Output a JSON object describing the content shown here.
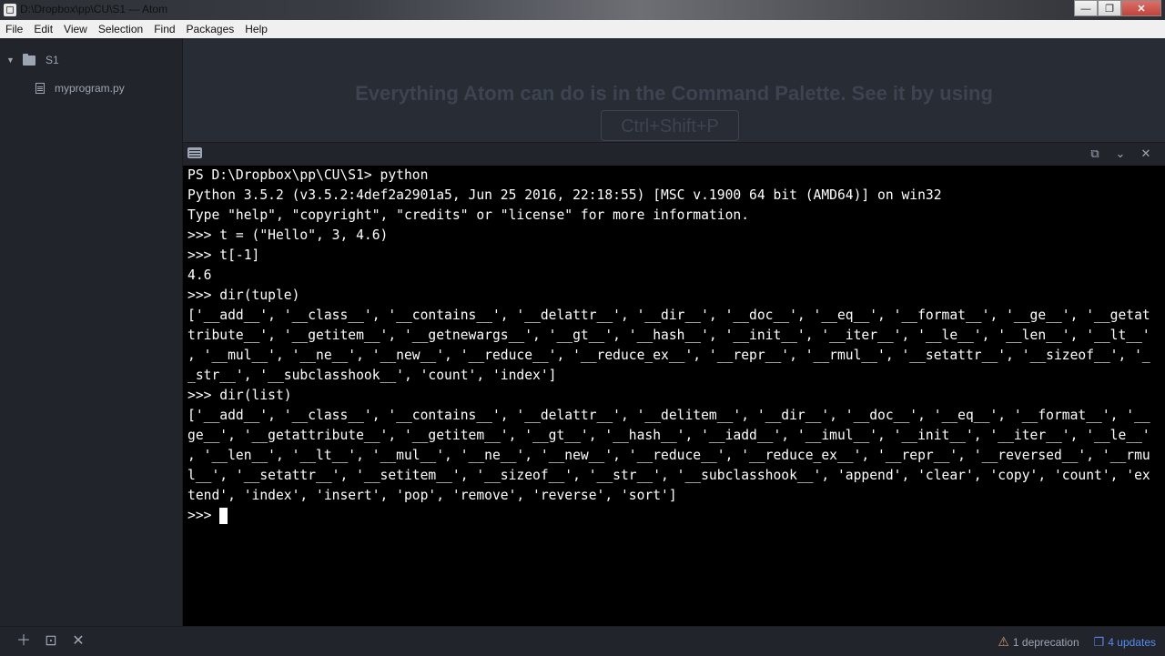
{
  "window": {
    "title": "D:\\Dropbox\\pp\\CU\\S1 — Atom",
    "min_glyph": "—",
    "max_glyph": "❐",
    "close_glyph": "✕"
  },
  "menu": [
    "File",
    "Edit",
    "View",
    "Selection",
    "Find",
    "Packages",
    "Help"
  ],
  "tree": {
    "folder": "S1",
    "file": "myprogram.py"
  },
  "workspace": {
    "hint": "Everything Atom can do is in the Command Palette. See it by using",
    "shortcut": "Ctrl+Shift+P"
  },
  "terminal": {
    "lines": [
      "PS D:\\Dropbox\\pp\\CU\\S1> python",
      "Python 3.5.2 (v3.5.2:4def2a2901a5, Jun 25 2016, 22:18:55) [MSC v.1900 64 bit (AMD64)] on win32",
      "Type \"help\", \"copyright\", \"credits\" or \"license\" for more information.",
      ">>> t = (\"Hello\", 3, 4.6)",
      ">>> t[-1]",
      "4.6",
      ">>> dir(tuple)",
      "['__add__', '__class__', '__contains__', '__delattr__', '__dir__', '__doc__', '__eq__', '__format__', '__ge__', '__getat",
      "tribute__', '__getitem__', '__getnewargs__', '__gt__', '__hash__', '__init__', '__iter__', '__le__', '__len__', '__lt__'",
      ", '__mul__', '__ne__', '__new__', '__reduce__', '__reduce_ex__', '__repr__', '__rmul__', '__setattr__', '__sizeof__', '_",
      "_str__', '__subclasshook__', 'count', 'index']",
      ">>> dir(list)",
      "['__add__', '__class__', '__contains__', '__delattr__', '__delitem__', '__dir__', '__doc__', '__eq__', '__format__', '__",
      "ge__', '__getattribute__', '__getitem__', '__gt__', '__hash__', '__iadd__', '__imul__', '__init__', '__iter__', '__le__'",
      ", '__len__', '__lt__', '__mul__', '__ne__', '__new__', '__reduce__', '__reduce_ex__', '__repr__', '__reversed__', '__rmu",
      "l__', '__setattr__', '__setitem__', '__sizeof__', '__str__', '__subclasshook__', 'append', 'clear', 'copy', 'count', 'ex",
      "tend', 'index', 'insert', 'pop', 'remove', 'reverse', 'sort']"
    ],
    "prompt": ">>> "
  },
  "status": {
    "deprecation": "1 deprecation",
    "updates": "4 updates"
  }
}
